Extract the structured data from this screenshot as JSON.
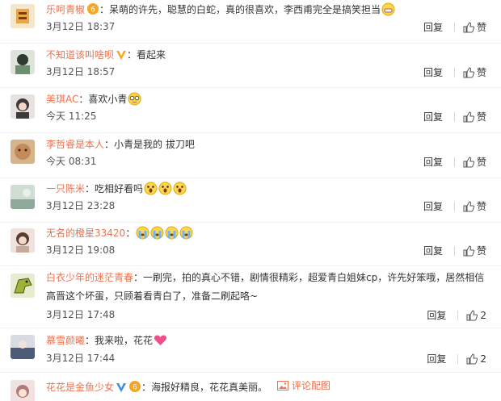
{
  "comments": [
    {
      "user": "乐呵青椒",
      "text": "呆萌的许先，聪慧的白蛇，真的很喜欢，李西甫完全是搞笑担当",
      "time": "3月12日 18:37",
      "reply": "回复",
      "like": "赞",
      "avatar_color": "#e9a64b"
    },
    {
      "user": "不知道该叫啥呗",
      "text": "看起来",
      "time": "3月12日 18:57",
      "reply": "回复",
      "like": "赞",
      "avatar_color": "#6b8f70"
    },
    {
      "user": "美琪AC",
      "text": "喜欢小青",
      "time": "今天 11:25",
      "reply": "回复",
      "like": "赞",
      "avatar_color": "#3e3a3c"
    },
    {
      "user": "李哲睿是本人",
      "text": "小青是我的 拔刀吧",
      "time": "今天 08:31",
      "reply": "回复",
      "like": "赞",
      "avatar_color": "#c48a5a"
    },
    {
      "user": "一只陈米",
      "text": "吃相好看吗",
      "time": "3月12日 23:28",
      "reply": "回复",
      "like": "赞",
      "avatar_color": "#8faa9a"
    },
    {
      "user": "无名的橙星33420",
      "text": "",
      "time": "3月12日 19:08",
      "reply": "回复",
      "like": "赞",
      "avatar_color": "#c8a99a"
    },
    {
      "user": "白衣少年的迷茫青春",
      "text": "一刷完，拍的真心不错，剧情很精彩，超爱青白姐妹cp，许先好笨哦，居然相信高晋这个坏蛋，只顾着看青白了，准备二刷起咯~",
      "time": "3月12日 17:48",
      "reply": "回复",
      "like": "2",
      "avatar_color": "#9fb33a"
    },
    {
      "user": "慕雪颜曦",
      "text": "我来啦，花花",
      "time": "3月12日 17:44",
      "reply": "回复",
      "like": "2",
      "avatar_color": "#4d5a78"
    },
    {
      "user": "花花是金鱼少女",
      "text": "海报好精良，花花真美丽。",
      "pic_link": "评论配图",
      "avatar_color": "#b07b7b"
    }
  ],
  "colors": {
    "username": "#eb7350",
    "accent_blue": "#3d8dd9",
    "accent_gold": "#f5a623"
  }
}
